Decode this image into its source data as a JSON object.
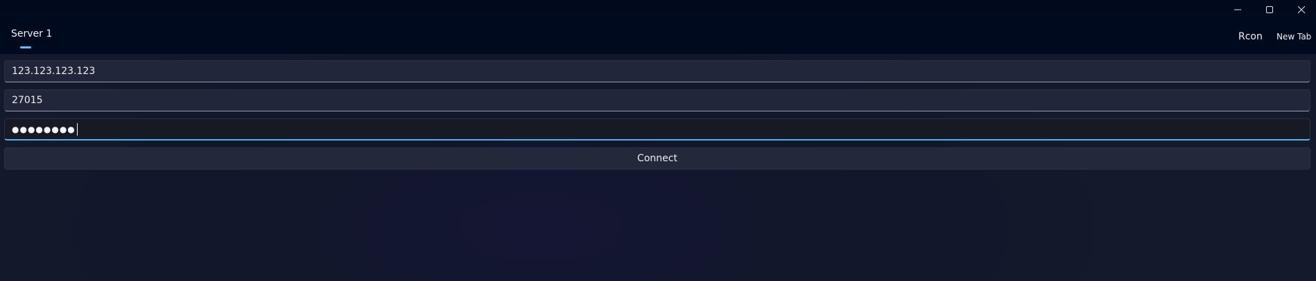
{
  "window": {
    "controls": {
      "minimize_icon": "minimize-icon",
      "maximize_icon": "maximize-icon",
      "close_icon": "close-icon"
    }
  },
  "header": {
    "tabs": [
      {
        "label": "Server 1",
        "selected": true
      }
    ],
    "app_title": "Rcon",
    "new_tab_label": "New Tab",
    "accent_color": "#5cc6f2"
  },
  "form": {
    "ip": {
      "value": "123.123.123.123"
    },
    "port": {
      "value": "27015"
    },
    "password": {
      "masked_value": "●●●●●●●●",
      "focused": true
    },
    "connect_label": "Connect"
  }
}
